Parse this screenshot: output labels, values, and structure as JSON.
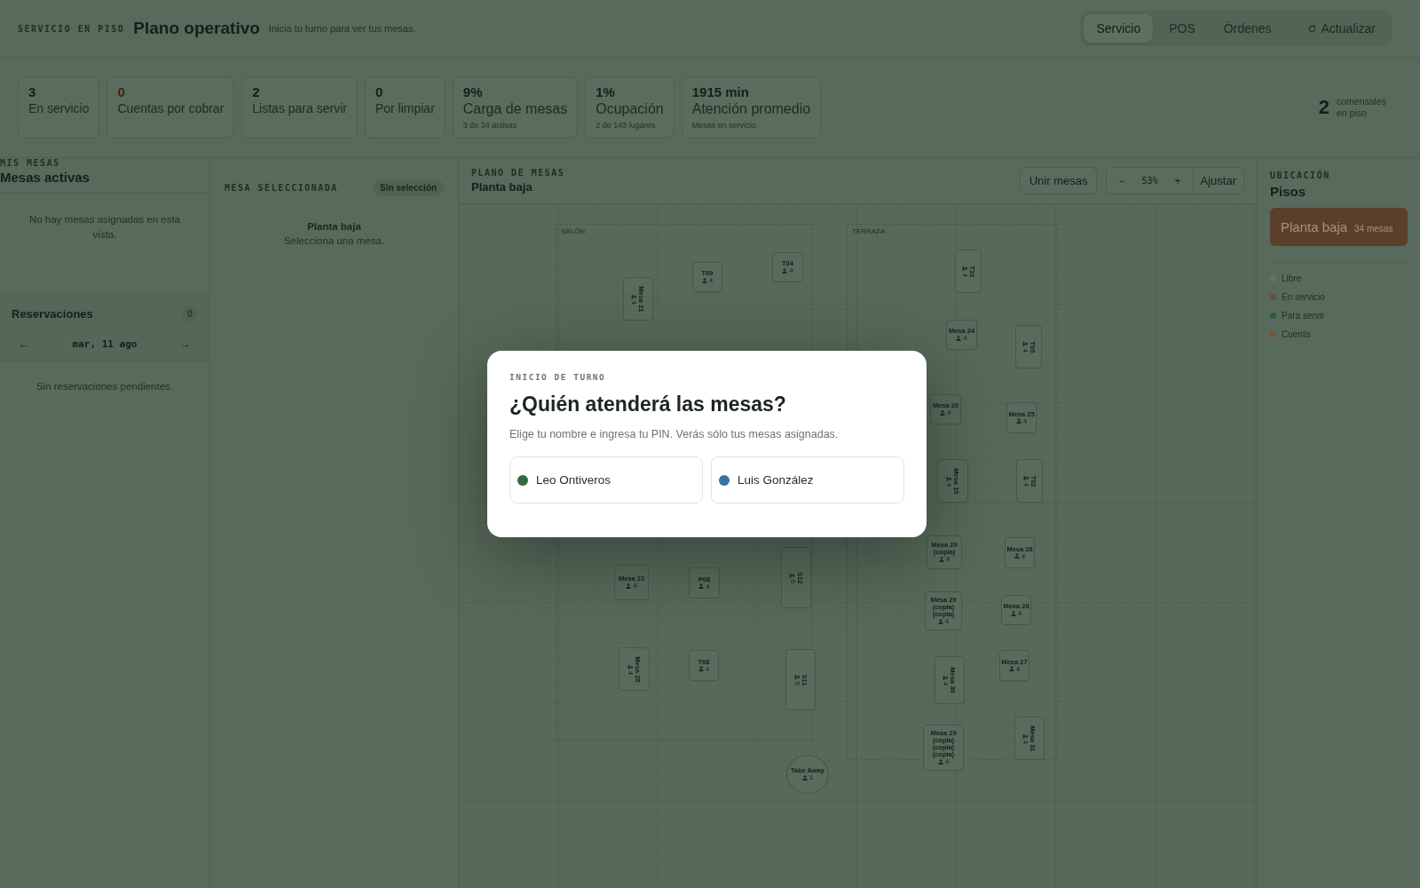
{
  "header": {
    "eyebrow": "SERVICIO EN PISO",
    "title": "Plano operativo",
    "subtitle": "Inicia tu turno para ver tus mesas.",
    "tabs": [
      {
        "label": "Servicio",
        "selected": true
      },
      {
        "label": "POS",
        "selected": false
      },
      {
        "label": "Órdenes",
        "selected": false
      }
    ],
    "refresh": "Actualizar"
  },
  "stats": [
    {
      "value": "3",
      "label": "En servicio",
      "kind": "normal"
    },
    {
      "value": "0",
      "label": "Cuentas por cobrar",
      "kind": "warning"
    },
    {
      "value": "2",
      "label": "Listas para servir",
      "kind": "normal"
    },
    {
      "value": "0",
      "label": "Por limpiar",
      "kind": "normal"
    },
    {
      "value": "9%",
      "label": "Carga de mesas",
      "sub": "3 de 34 activas",
      "kind": "normal"
    },
    {
      "value": "1%",
      "label": "Ocupación",
      "sub": "2 de 143 lugares",
      "kind": "normal"
    },
    {
      "value": "1915 min",
      "label": "Atención promedio",
      "sub": "Mesas en servicio",
      "kind": "normal"
    }
  ],
  "diners": {
    "value": "2",
    "label": "comensales en piso"
  },
  "my_tables": {
    "eyebrow": "MIS MESAS",
    "title": "Mesas activas",
    "empty": "No hay mesas asignadas en esta vista."
  },
  "reservations": {
    "title": "Reservaciones",
    "count": "0",
    "prev": "←",
    "date": "mar, 11 ago",
    "next": "→",
    "empty": "Sin reservaciones pendientes."
  },
  "selected_table": {
    "eyebrow": "MESA SELECCIONADA",
    "badge": "Sin selección",
    "floor": "Planta baja",
    "hint": "Selecciona una mesa."
  },
  "plan": {
    "eyebrow": "PLANO DE MESAS",
    "title": "Planta baja",
    "join": "Unir mesas",
    "zoom_out": "−",
    "zoom": "53%",
    "zoom_in": "+",
    "fit": "Ajustar",
    "zones": [
      {
        "name": "SALÓN"
      },
      {
        "name": "TERRAZA"
      }
    ],
    "tables": [
      {
        "name": "Mesa 21",
        "seats": "4",
        "kind": "rect",
        "rotated": true
      },
      {
        "name": "T09",
        "seats": "4",
        "kind": "rect",
        "rotated": false
      },
      {
        "name": "T04",
        "seats": "4",
        "kind": "rect",
        "rotated": false
      },
      {
        "name": "T32",
        "seats": "4",
        "kind": "rect",
        "rotated": true
      },
      {
        "name": "Mesa 24",
        "seats": "4",
        "kind": "rect",
        "rotated": false
      },
      {
        "name": "T06",
        "seats": "4",
        "kind": "rect",
        "rotated": true
      },
      {
        "name": "Mesa 20",
        "seats": "4",
        "kind": "rect",
        "rotated": false
      },
      {
        "name": "Mesa 25",
        "seats": "4",
        "kind": "rect",
        "rotated": false
      },
      {
        "name": "Mesa 15",
        "seats": "4",
        "kind": "rect",
        "rotated": true
      },
      {
        "name": "T02",
        "seats": "4",
        "kind": "rect",
        "rotated": true
      },
      {
        "name": "Mesa 29 (copia)",
        "seats": "4",
        "kind": "rect",
        "rotated": false
      },
      {
        "name": "Mesa 26",
        "seats": "4",
        "kind": "rect",
        "rotated": false
      },
      {
        "name": "S12",
        "seats": "6",
        "kind": "rect",
        "rotated": true
      },
      {
        "name": "Mesa 23",
        "seats": "4",
        "kind": "rect",
        "rotated": false
      },
      {
        "name": "P08",
        "seats": "4",
        "kind": "rect",
        "rotated": false
      },
      {
        "name": "Mesa 29 (copia) (copia)",
        "seats": "4",
        "kind": "rect",
        "rotated": false
      },
      {
        "name": "Mesa 28",
        "seats": "4",
        "kind": "rect",
        "rotated": false
      },
      {
        "name": "Mesa 25",
        "seats": "4",
        "kind": "rect",
        "rotated": true
      },
      {
        "name": "T08",
        "seats": "4",
        "kind": "rect",
        "rotated": false
      },
      {
        "name": "S11",
        "seats": "6",
        "kind": "rect",
        "rotated": true
      },
      {
        "name": "Mesa 30",
        "seats": "4",
        "kind": "rect",
        "rotated": true
      },
      {
        "name": "Mesa 27",
        "seats": "4",
        "kind": "rect",
        "rotated": false
      },
      {
        "name": "Mesa 29 (copia) (copia) (copia)",
        "seats": "4",
        "kind": "rect",
        "rotated": false
      },
      {
        "name": "Mesa 31",
        "seats": "4",
        "kind": "rect",
        "rotated": true
      },
      {
        "name": "Take Away",
        "seats": "1",
        "kind": "round",
        "rotated": false
      }
    ]
  },
  "location": {
    "eyebrow": "UBICACIÓN",
    "title": "Pisos",
    "floors": [
      {
        "name": "Planta baja",
        "count": "34 mesas",
        "selected": true
      }
    ],
    "legend": [
      {
        "label": "Libre",
        "color": "#62756a"
      },
      {
        "label": "En servicio",
        "color": "#6b4a35"
      },
      {
        "label": "Para servir",
        "color": "#2f5a3a"
      },
      {
        "label": "Cuenta",
        "color": "#7a5533"
      }
    ]
  },
  "modal": {
    "eyebrow": "INICIO DE TURNO",
    "title": "¿Quién atenderá las mesas?",
    "text": "Elige tu nombre e ingresa tu PIN. Verás sólo tus mesas asignadas.",
    "staff": [
      {
        "name": "Leo Ontiveros",
        "color": "#2f6b3f"
      },
      {
        "name": "Luis González",
        "color": "#3572a8"
      }
    ]
  }
}
